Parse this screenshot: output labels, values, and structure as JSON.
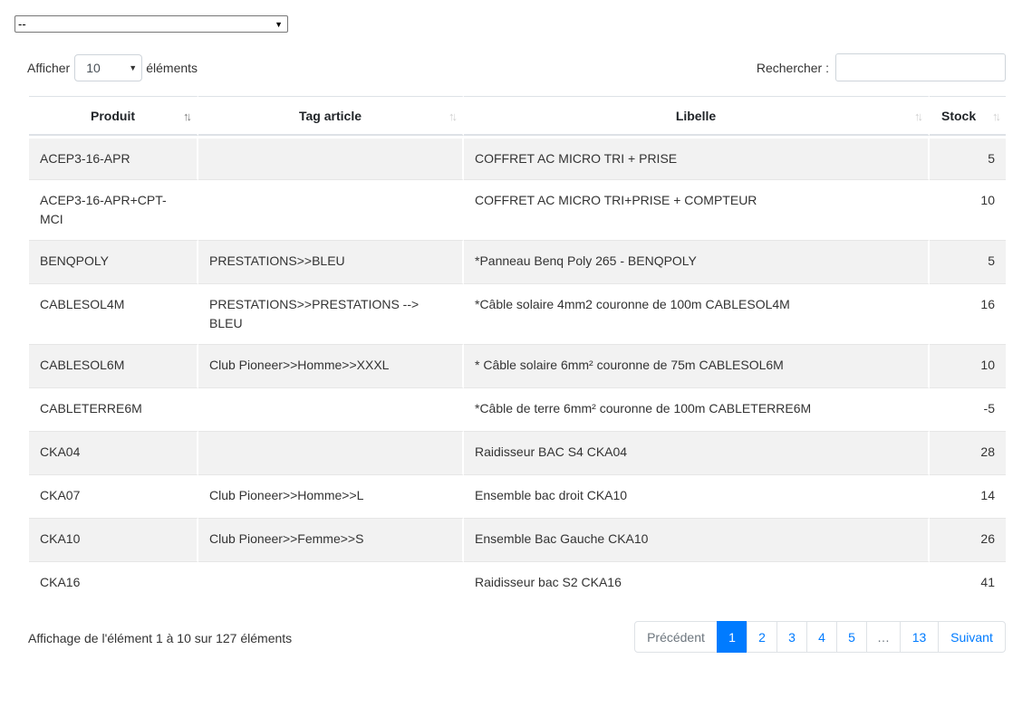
{
  "top_select": {
    "value": "--"
  },
  "length": {
    "before": "Afficher",
    "value": "10",
    "after": "éléments"
  },
  "search": {
    "label": "Rechercher :",
    "value": ""
  },
  "table": {
    "columns": [
      "Produit",
      "Tag article",
      "Libelle",
      "Stock"
    ],
    "rows": [
      [
        "ACEP3-16-APR",
        "",
        "COFFRET AC MICRO TRI + PRISE",
        "5"
      ],
      [
        "ACEP3-16-APR+CPT-MCI",
        "",
        "COFFRET AC MICRO TRI+PRISE + COMPTEUR",
        "10"
      ],
      [
        "BENQPOLY",
        "PRESTATIONS>>BLEU",
        "*Panneau Benq Poly 265 - BENQPOLY",
        "5"
      ],
      [
        "CABLESOL4M",
        "PRESTATIONS>>PRESTATIONS --> BLEU",
        "*Câble solaire 4mm2 couronne de 100m CABLESOL4M",
        "16"
      ],
      [
        "CABLESOL6M",
        "Club Pioneer>>Homme>>XXXL",
        "* Câble solaire 6mm² couronne de 75m CABLESOL6M",
        "10"
      ],
      [
        "CABLETERRE6M",
        "",
        "*Câble de terre 6mm² couronne de 100m CABLETERRE6M",
        "-5"
      ],
      [
        "CKA04",
        "",
        "Raidisseur BAC S4 CKA04",
        "28"
      ],
      [
        "CKA07",
        "Club Pioneer>>Homme>>L",
        "Ensemble bac droit CKA10",
        "14"
      ],
      [
        "CKA10",
        "Club Pioneer>>Femme>>S",
        "Ensemble Bac Gauche CKA10",
        "26"
      ],
      [
        "CKA16",
        "",
        "Raidisseur bac S2 CKA16",
        "41"
      ]
    ]
  },
  "info": "Affichage de l'élément 1 à 10 sur 127 éléments",
  "pagination": {
    "previous": "Précédent",
    "pages": [
      "1",
      "2",
      "3",
      "4",
      "5",
      "…",
      "13"
    ],
    "active": "1",
    "next": "Suivant"
  },
  "colors": {
    "accent": "#007bff",
    "stripe": "#f2f2f2"
  },
  "icons": {
    "sort_active": "sort-ascending-icon",
    "sort_inactive": "sort-both-icon"
  }
}
